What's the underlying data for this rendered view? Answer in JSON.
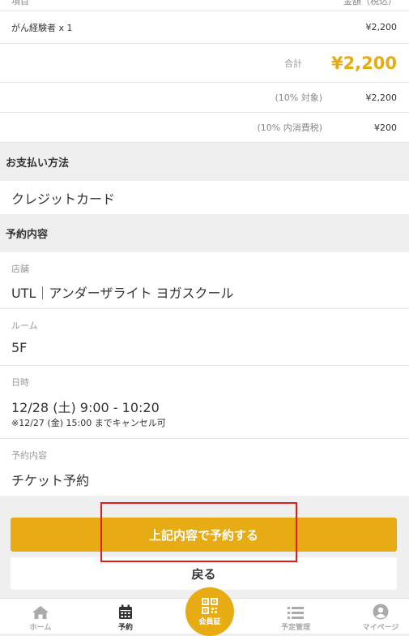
{
  "price_table": {
    "header_item": "項目",
    "header_amount": "金額（税込）",
    "line_item": {
      "label": "がん経験者 x 1",
      "amount": "¥2,200"
    },
    "total": {
      "label": "合計",
      "amount": "¥2,200"
    },
    "taxable": {
      "label": "(10% 対象)",
      "amount": "¥2,200"
    },
    "tax": {
      "label": "(10% 内消費税)",
      "amount": "¥200"
    }
  },
  "payment": {
    "section_title": "お支払い方法",
    "method": "クレジットカード"
  },
  "reservation": {
    "section_title": "予約内容",
    "store_label": "店舗",
    "store_value": "UTL｜アンダーザライト ヨガスクール",
    "room_label": "ルーム",
    "room_value": "5F",
    "datetime_label": "日時",
    "datetime_value": "12/28 (土) 9:00 - 10:20",
    "cancel_note": "※12/27 (金) 15:00 までキャンセル可",
    "content_label": "予約内容",
    "content_value": "チケット予約"
  },
  "actions": {
    "confirm_label": "上記内容で予約する",
    "back_label": "戻る"
  },
  "tabbar": {
    "home": "ホーム",
    "reserve": "予約",
    "member_card": "会員証",
    "schedule": "予定管理",
    "mypage": "マイページ"
  },
  "colors": {
    "accent": "#e7ab13",
    "highlight": "#e01d1d"
  }
}
